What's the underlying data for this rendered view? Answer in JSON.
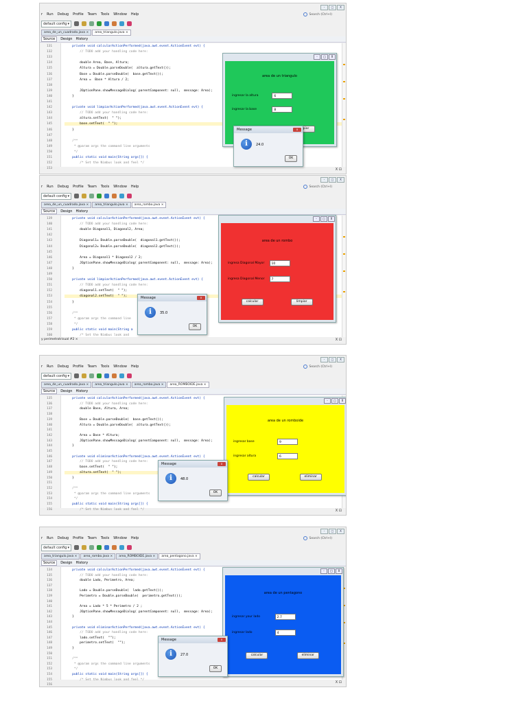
{
  "common": {
    "menu": [
      "r",
      "Run",
      "Debug",
      "Profile",
      "Team",
      "Tools",
      "Window",
      "Help"
    ],
    "search_placeholder": "Search (Ctrl+I)",
    "config": "default config",
    "editor_tabs_label": [
      "Source",
      "Design",
      "History"
    ],
    "win_buttons": [
      "-",
      "□",
      "X"
    ],
    "ok": "OK",
    "message_title": "Message",
    "status_text": "X ⊡"
  },
  "shots": [
    {
      "file_tabs": [
        "area_de_un_cuadrado.java ×",
        "area_triangulo.java ×"
      ],
      "active_tab": 1,
      "line_numbers": [
        "131",
        "132",
        "133",
        "134",
        "135",
        "136",
        "137",
        "138",
        "139",
        "140",
        "141",
        "142",
        "143",
        "144",
        "145",
        "146",
        "147",
        "148",
        "149",
        "150",
        "151",
        "152",
        "153"
      ],
      "code": [
        {
          "t": "    private void calcularActionPerformed(java.awt.event.ActionEvent evt) {",
          "c": "kw"
        },
        {
          "t": "        // TODO add your handling code here:",
          "c": "cm"
        },
        {
          "t": "",
          "c": ""
        },
        {
          "t": "        double Area, Base, Altura;",
          "c": ""
        },
        {
          "t": "        Altura = Double.parseDouble(  altura.getText());",
          "c": ""
        },
        {
          "t": "        Base = Double.parseDouble(  base.getText());",
          "c": ""
        },
        {
          "t": "        Area =  Base * Altura / 2;",
          "c": ""
        },
        {
          "t": "",
          "c": ""
        },
        {
          "t": "        JOptionPane.showMessageDialog( parentComponent: null,  message: Area);",
          "c": ""
        },
        {
          "t": "    }",
          "c": ""
        },
        {
          "t": "",
          "c": ""
        },
        {
          "t": "    private void limpiarActionPerformed(java.awt.event.ActionEvent evt) {",
          "c": "kw"
        },
        {
          "t": "        // TODO add your handling code here:",
          "c": "cm"
        },
        {
          "t": "        altura.setText(  \" \");",
          "c": ""
        },
        {
          "t": "        base.setText(  \" \");",
          "c": "hl"
        },
        {
          "t": "    }",
          "c": ""
        },
        {
          "t": "",
          "c": ""
        },
        {
          "t": "    /**",
          "c": "cm"
        },
        {
          "t": "     * @param args the command line arguments",
          "c": "cm"
        },
        {
          "t": "     */",
          "c": "cm"
        },
        {
          "t": "    public static void main(String args[]) {",
          "c": "kw"
        },
        {
          "t": "        /* Set the Nimbus look and feel */",
          "c": "cm"
        }
      ],
      "frame": {
        "color": "#1fc85a",
        "title": "area de un triangulo",
        "label1": "ingresar la altura",
        "value1": "6",
        "label2": "ingresar la base",
        "value2": "8",
        "btn1": "calcular",
        "btn2": "limpiar"
      },
      "message_value": "24.0"
    },
    {
      "file_tabs": [
        "area_de_un_cuadrado.java ×",
        "area_triangulo.java ×",
        "area_rombo.java ×"
      ],
      "active_tab": 2,
      "line_numbers": [
        "139",
        "140",
        "141",
        "142",
        "143",
        "144",
        "145",
        "146",
        "147",
        "148",
        "149",
        "150",
        "151",
        "152",
        "153",
        "154",
        "155",
        "156",
        "157",
        "158",
        "159",
        "160"
      ],
      "code": [
        {
          "t": "    private void calcularActionPerformed(java.awt.event.ActionEvent evt) {",
          "c": "kw"
        },
        {
          "t": "        // TODO add your handling code here:",
          "c": "cm"
        },
        {
          "t": "        double Diagonal1, Diagonal2, Area;",
          "c": ""
        },
        {
          "t": "",
          "c": ""
        },
        {
          "t": "        Diagonal1= Double.parseDouble(  diagonal1.getText());",
          "c": ""
        },
        {
          "t": "        Diagonal2= Double.parseDouble(  diagonal2.getText());",
          "c": ""
        },
        {
          "t": "",
          "c": ""
        },
        {
          "t": "        Area = Diagonal1 * Diagonal2 / 2;",
          "c": ""
        },
        {
          "t": "        JOptionPane.showMessageDialog( parentComponent: null,  message: Area);",
          "c": ""
        },
        {
          "t": "    }",
          "c": ""
        },
        {
          "t": "",
          "c": ""
        },
        {
          "t": "    private void limpiarActionPerformed(java.awt.event.ActionEvent evt) {",
          "c": "kw"
        },
        {
          "t": "        // TODO add your handling code here:",
          "c": "cm"
        },
        {
          "t": "        diagonal1.setText(  \" \");",
          "c": ""
        },
        {
          "t": "        diagonal2.setText(  \" \");",
          "c": "hl"
        },
        {
          "t": "    }",
          "c": ""
        },
        {
          "t": "",
          "c": ""
        },
        {
          "t": "    /**",
          "c": "cm"
        },
        {
          "t": "     * @param args the command line",
          "c": "cm"
        },
        {
          "t": "     */",
          "c": "cm"
        },
        {
          "t": "    public static void main(String a",
          "c": "kw"
        },
        {
          "t": "        /* Set the Nimbus look and",
          "c": "cm"
        }
      ],
      "frame": {
        "color": "#f03131",
        "title": "area de un rombo",
        "label1": "ingresa Diagonal Mayor",
        "value1": "10",
        "label2": "ingresa Diagonal Menor",
        "value2": "7",
        "btn1": "calcular",
        "btn2": "limpiar"
      },
      "message_value": "35.0",
      "extra_tab": "y perimetrotrisual #2 ×"
    },
    {
      "file_tabs": [
        "area_de_un_cuadrado.java ×",
        "area_triangulo.java ×",
        "area_rombo.java ×",
        "area_ROMBOIDE.java ×"
      ],
      "active_tab": 3,
      "line_numbers": [
        "135",
        "136",
        "137",
        "138",
        "139",
        "140",
        "141",
        "142",
        "143",
        "144",
        "145",
        "146",
        "147",
        "148",
        "149",
        "150",
        "151",
        "152",
        "153",
        "154",
        "155",
        "156"
      ],
      "code": [
        {
          "t": "    private void calcularActionPerformed(java.awt.event.ActionEvent evt) {",
          "c": "kw"
        },
        {
          "t": "        // TODO add your handling code here:",
          "c": "cm"
        },
        {
          "t": "        double Base, Altura, Area;",
          "c": ""
        },
        {
          "t": "",
          "c": ""
        },
        {
          "t": "        Base = Double.parseDouble(  base.getText());",
          "c": ""
        },
        {
          "t": "        Altura = Double.parseDouble(  altura.getText());",
          "c": ""
        },
        {
          "t": "",
          "c": ""
        },
        {
          "t": "        Area = Base * Altura;",
          "c": ""
        },
        {
          "t": "        JOptionPane.showMessageDialog( parentComponent: null,  message: Area);",
          "c": ""
        },
        {
          "t": "    }",
          "c": ""
        },
        {
          "t": "",
          "c": ""
        },
        {
          "t": "    private void eliminarActionPerformed(java.awt.event.ActionEvent evt) {",
          "c": "kw"
        },
        {
          "t": "        // TODO add your handling code here:",
          "c": "cm"
        },
        {
          "t": "        base.setText(  \" \");",
          "c": ""
        },
        {
          "t": "        altura.setText(  \" \");",
          "c": "hl"
        },
        {
          "t": "    }",
          "c": ""
        },
        {
          "t": "",
          "c": ""
        },
        {
          "t": "    /**",
          "c": "cm"
        },
        {
          "t": "     * @param args the command line arguments",
          "c": "cm"
        },
        {
          "t": "     */",
          "c": "cm"
        },
        {
          "t": "    public static void main(String args[]) {",
          "c": "kw"
        },
        {
          "t": "        /* Set the Nimbus look and feel */",
          "c": "cm"
        }
      ],
      "frame": {
        "color": "#ffff00",
        "title": "area de un romboide",
        "label1": "ingresar base",
        "value1": "9",
        "label2": "ingresar altura",
        "value2": "6",
        "btn1": "calcular",
        "btn2": "eliminar"
      },
      "message_value": "48.0",
      "extra_tab": ""
    },
    {
      "file_tabs": [
        "area_triangulo.java ×",
        "area_rombo.java ×",
        "area_ROMBOIDE.java ×",
        "area_pentagono.java ×"
      ],
      "active_tab": 3,
      "line_numbers": [
        "134",
        "135",
        "136",
        "137",
        "138",
        "139",
        "140",
        "141",
        "142",
        "143",
        "144",
        "145",
        "146",
        "147",
        "148",
        "149",
        "150",
        "151",
        "152",
        "153",
        "154",
        "155",
        "156",
        "157",
        "158"
      ],
      "code": [
        {
          "t": "    private void calcularActionPerformed(java.awt.event.ActionEvent evt) {",
          "c": "kw"
        },
        {
          "t": "        // TODO add your handling code here:",
          "c": "cm"
        },
        {
          "t": "        double Lado, Perimetro, Area;",
          "c": ""
        },
        {
          "t": "",
          "c": ""
        },
        {
          "t": "        Lado = Double.parseDouble(  lado.getText());",
          "c": ""
        },
        {
          "t": "        Perimetro = Double.parseDouble(  perimetro.getText());",
          "c": ""
        },
        {
          "t": "",
          "c": ""
        },
        {
          "t": "        Area = Lado * 5 * Perimetro / 2 ;",
          "c": ""
        },
        {
          "t": "        JOptionPane.showMessageDialog( parentComponent: null,  message: Area);",
          "c": ""
        },
        {
          "t": "    }",
          "c": ""
        },
        {
          "t": "",
          "c": ""
        },
        {
          "t": "    private void eliminarActionPerformed(java.awt.event.ActionEvent evt) {",
          "c": "kw"
        },
        {
          "t": "        // TODO add your handling code here:",
          "c": "cm"
        },
        {
          "t": "        lado.setText(  \"\");",
          "c": ""
        },
        {
          "t": "        perimetro.setText(  \"\");",
          "c": ""
        },
        {
          "t": "    }",
          "c": ""
        },
        {
          "t": "",
          "c": ""
        },
        {
          "t": "    /**",
          "c": "cm"
        },
        {
          "t": "     * @param args the command line arguments",
          "c": "cm"
        },
        {
          "t": "     */",
          "c": "cm"
        },
        {
          "t": "    public static void main(String args[]) {",
          "c": "kw"
        },
        {
          "t": "        /* Set the Nimbus look and feel */",
          "c": "cm"
        }
      ],
      "frame": {
        "color": "#0a5cf2",
        "title": "area de un pentagono",
        "label1": "ingresar your lado",
        "value1": "2.7",
        "label2": "ingresar lado",
        "value2": "4",
        "btn1": "calcular",
        "btn2": "eliminar"
      },
      "message_value": "27.0",
      "extra_tab": ""
    }
  ]
}
